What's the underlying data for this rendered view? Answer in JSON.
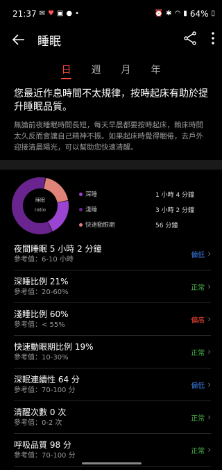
{
  "status": {
    "time": "21:37",
    "battery": "64%"
  },
  "header": {
    "title": "睡眠"
  },
  "tabs": [
    {
      "label": "日",
      "active": true
    },
    {
      "label": "週",
      "active": false
    },
    {
      "label": "月",
      "active": false
    },
    {
      "label": "年",
      "active": false
    }
  ],
  "tip": {
    "title": "您最近作息時間不太規律，按時起床有助於提升睡眠品質。",
    "body": "無論前夜睡眠時間長短，每天早晨都要按時起床，賴床時間太久反而會讓自己精神不振。如果起床時覺得睏倦，去戶外迎接清晨陽光，可以幫助您快速清醒。"
  },
  "donut": {
    "center_line1": "睡眠",
    "center_line2": "ratio",
    "segments": [
      {
        "name": "深睡",
        "percent": 21,
        "color": "#9b44d1"
      },
      {
        "name": "淺睡",
        "percent": 60,
        "color": "#6a2490"
      },
      {
        "name": "快速動眼期",
        "percent": 19,
        "color": "#e08479"
      }
    ]
  },
  "legend": [
    {
      "label": "深睡",
      "value": "1 小時 4 分鐘",
      "color": "#9b44d1"
    },
    {
      "label": "淺睡",
      "value": "3 小時 2 分鐘",
      "color": "#6a2490"
    },
    {
      "label": "快速動眼期",
      "value": "56 分鐘",
      "color": "#e08479"
    }
  ],
  "metrics": [
    {
      "label": "夜間睡眠  5 小時 2 分鐘",
      "ref": "參考值：6-10 小時",
      "status": "偏低",
      "status_color": "#3d7eea"
    },
    {
      "label": "深睡比例  21%",
      "ref": "參考值：20-60%",
      "status": "正常",
      "status_color": "#46b249"
    },
    {
      "label": "淺睡比例  60%",
      "ref": "參考值：< 55%",
      "status": "偏高",
      "status_color": "#ff4a3a"
    },
    {
      "label": "快速動眼期比例  19%",
      "ref": "參考值：10-30%",
      "status": "正常",
      "status_color": "#46b249"
    },
    {
      "label": "深眠連續性  64 分",
      "ref": "參考值：70-100 分",
      "status": "偏低",
      "status_color": "#3d7eea"
    },
    {
      "label": "清醒次數  0 次",
      "ref": "參考值：0-2 次",
      "status": "正常",
      "status_color": "#46b249"
    },
    {
      "label": "呼吸品質  98 分",
      "ref": "參考值：70-100 分",
      "status": "正常",
      "status_color": "#46b249"
    }
  ]
}
